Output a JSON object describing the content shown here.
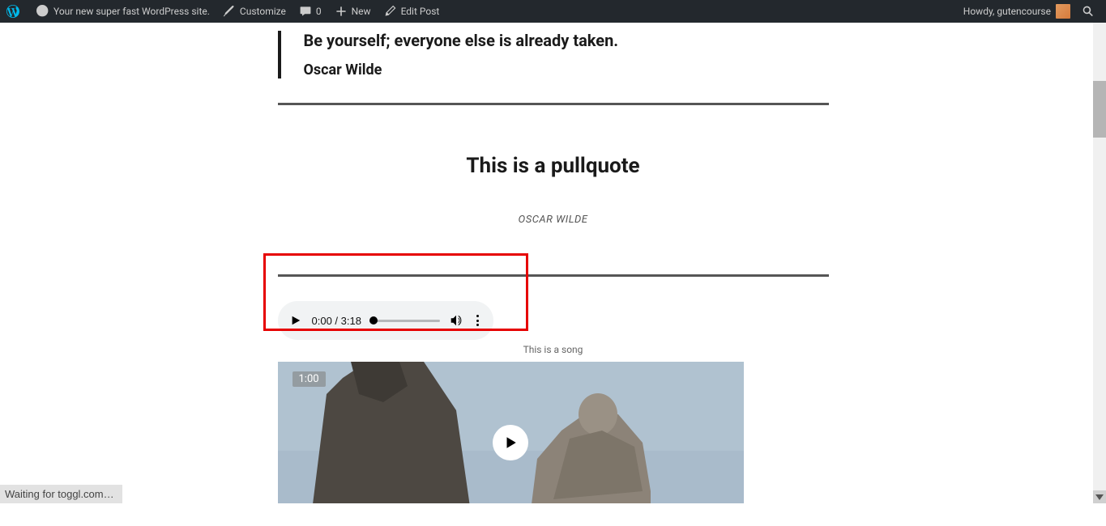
{
  "adminbar": {
    "site_name": "Your new super fast WordPress site.",
    "customize": "Customize",
    "comments_count": "0",
    "new_label": "New",
    "edit_post": "Edit Post",
    "greeting": "Howdy, gutencourse"
  },
  "blockquote": {
    "text": "Be yourself; everyone else is already taken.",
    "cite": "Oscar Wilde"
  },
  "pullquote": {
    "text": "This is a pullquote",
    "cite": "OSCAR WILDE"
  },
  "audio": {
    "current": "0:00",
    "total": "3:18",
    "caption": "This is a song"
  },
  "video": {
    "duration": "1:00"
  },
  "status": "Waiting for toggl.com…"
}
